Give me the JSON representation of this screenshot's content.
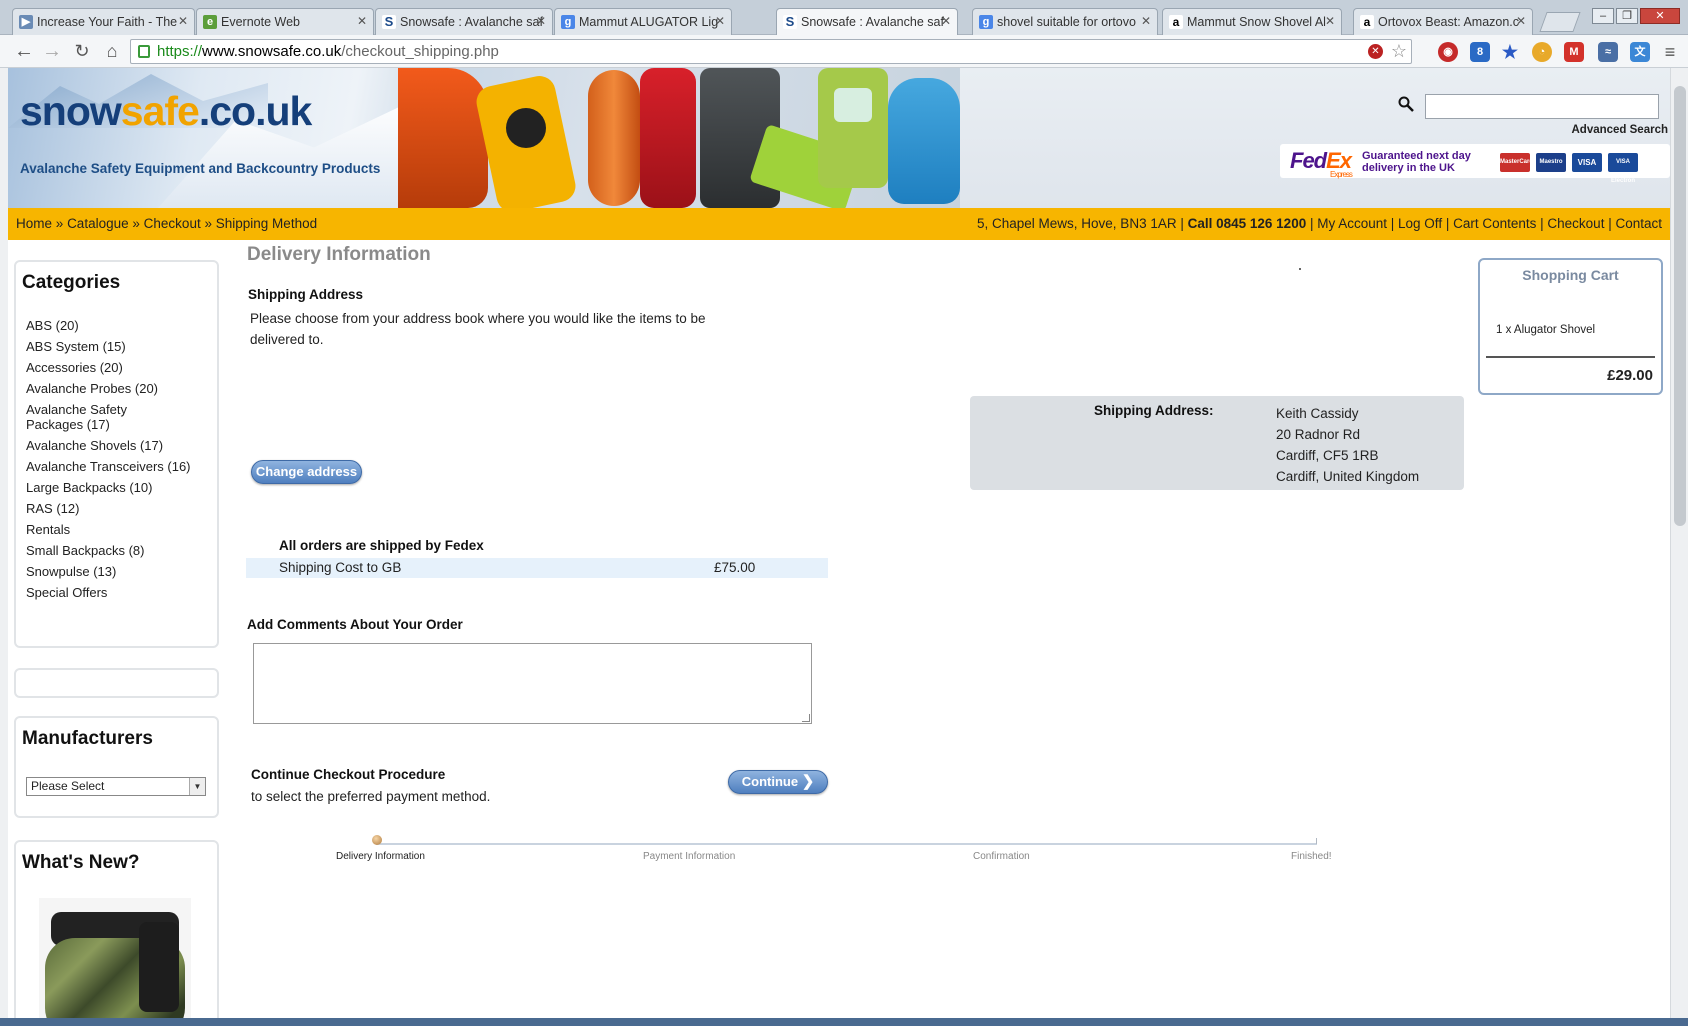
{
  "browser": {
    "tabs": [
      {
        "title": "Increase Your Faith - The",
        "favicon": "play-icon",
        "active": false
      },
      {
        "title": "Evernote Web",
        "favicon": "evernote-icon",
        "active": false
      },
      {
        "title": "Snowsafe : Avalanche saf",
        "favicon": "snowsafe-s-icon",
        "active": false
      },
      {
        "title": "Mammut ALUGATOR Lig",
        "favicon": "google-icon",
        "active": false
      },
      {
        "title": "Snowsafe : Avalanche saf",
        "favicon": "snowsafe-s-icon",
        "active": true
      },
      {
        "title": "shovel suitable for ortovo",
        "favicon": "google-icon",
        "active": false
      },
      {
        "title": "Mammut Snow Shovel Al",
        "favicon": "amazon-icon",
        "active": false
      },
      {
        "title": "Ortovox Beast: Amazon.c",
        "favicon": "amazon-icon",
        "active": false
      }
    ],
    "url": {
      "scheme": "https://",
      "host": "www.snowsafe.co.uk",
      "path": "/checkout_shipping.php"
    }
  },
  "site": {
    "logo": {
      "part1": "snow",
      "part2": "safe",
      "part3": ".co.uk"
    },
    "tagline": "Avalanche Safety Equipment and Backcountry Products",
    "search": {
      "placeholder": "",
      "advanced_label": "Advanced Search"
    },
    "fedex": {
      "logo_fe": "Fed",
      "logo_ex": "Ex",
      "logo_express": "Express",
      "line1": "Guaranteed next day",
      "line2": "delivery in the UK"
    },
    "cards": [
      "MasterCard",
      "Maestro",
      "VISA",
      "VISA Electron"
    ]
  },
  "breadcrumb": [
    "Home",
    "Catalogue",
    "Checkout",
    "Shipping Method"
  ],
  "breadcrumb_sep": "»",
  "toplinks": {
    "address": "5, Chapel Mews, Hove, BN3 1AR",
    "call": "Call 0845 126 1200",
    "links": [
      "My Account",
      "Log Off",
      "Cart Contents",
      "Checkout",
      "Contact"
    ]
  },
  "categories": {
    "title": "Categories",
    "items": [
      "ABS (20)",
      "ABS System (15)",
      "Accessories (20)",
      "Avalanche Probes (20)",
      "Avalanche Safety Packages (17)",
      "Avalanche Shovels (17)",
      "Avalanche Transceivers (16)",
      "Large Backpacks (10)",
      "RAS (12)",
      "Rentals",
      "Small Backpacks (8)",
      "Snowpulse (13)",
      "Special Offers"
    ]
  },
  "manufacturers": {
    "title": "Manufacturers",
    "selected": "Please Select"
  },
  "whats_new": {
    "title": "What's New?"
  },
  "delivery": {
    "title": "Delivery Information",
    "shipping_address_title": "Shipping Address",
    "shipping_address_text": "Please choose from your address book where you would like the items to be delivered to.",
    "change_address_label": "Change address",
    "address_label": "Shipping Address:",
    "address_lines": [
      "Keith Cassidy",
      "20 Radnor Rd",
      "Cardiff, CF5 1RB",
      "Cardiff, United Kingdom"
    ],
    "shipper_title": "All orders are shipped by Fedex",
    "shipping_cost_label": "Shipping Cost to GB",
    "shipping_cost_value": "£75.00",
    "comments_title": "Add Comments About Your Order",
    "comments_value": "",
    "continue_title": "Continue Checkout Procedure",
    "continue_text": "to select the preferred payment method.",
    "continue_label": "Continue"
  },
  "progress": {
    "steps": [
      "Delivery Information",
      "Payment Information",
      "Confirmation",
      "Finished!"
    ],
    "current_step": 0
  },
  "cart": {
    "title": "Shopping Cart",
    "items": [
      "1 x Alugator Shovel"
    ],
    "total": "£29.00"
  },
  "colors": {
    "accent_bar": "#f7b500",
    "button_blue": "#4f7fbf",
    "logo_blue": "#153f7a",
    "logo_orange": "#f1a300"
  }
}
